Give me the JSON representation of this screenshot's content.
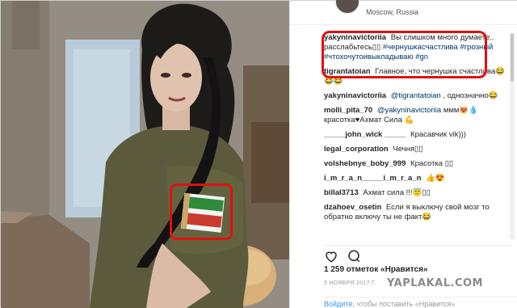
{
  "header": {
    "location": "Moscow, Russia"
  },
  "comments": [
    {
      "user": "yakyninavictoriia",
      "text": "Вы слишком много думаете.. расслабьтесь▯▯",
      "tags": "#чернушкасчастлива #грозный #чтохочутоивыкладываю #gn"
    },
    {
      "user": "tigrantatoian",
      "text": "Главное, что чернушка счастлива😂😂😂"
    },
    {
      "user": "yakyninavictoriia",
      "mention": "@tigrantatoian",
      "text": ", однозначно😂"
    },
    {
      "user": "molli_pita_70",
      "mention": "@yakyninavictoriia",
      "text": "ммм😻💧 красотка♥Ахмат Сила 💪"
    },
    {
      "user": "_____john_wick _____",
      "text": "Красавчик vik)))"
    },
    {
      "user": "legal_corporation",
      "text": "Чечня▯▯"
    },
    {
      "user": "volshebnye_boby_999",
      "text": "Красотка ▯▯"
    },
    {
      "user": "i_m_r_a_n_____i_m_r_a_n",
      "text": "👍😍"
    },
    {
      "user": "billal3713",
      "text": "Ахмат сила !!!😇▯▯"
    },
    {
      "user": "dzahoev_osetin",
      "text": "Если я выключу свой мозг то обратно включу ты не факт😂"
    }
  ],
  "actions": {
    "like_icon": "heart-icon",
    "comment_icon": "speech-bubble-icon"
  },
  "likes": "1 259 отметок «Нравится»",
  "date": "5 НОЯБРЯ 2017 Г.",
  "login": {
    "link": "Войдите",
    "text": ", чтобы поставить «Нравится»"
  },
  "watermark": "YAPLAKAL.COM",
  "colors": {
    "highlight": "#e01010",
    "link": "#3897f0",
    "tag": "#003569",
    "shirt": "#5a5a3c"
  }
}
